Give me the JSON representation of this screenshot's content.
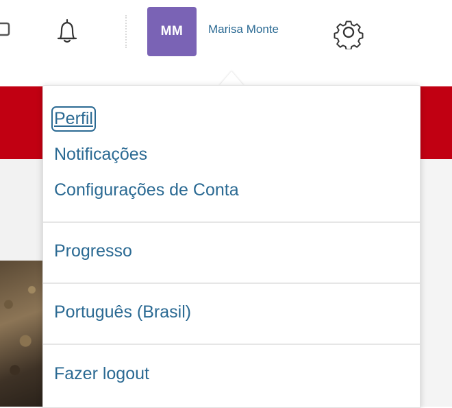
{
  "header": {
    "user_initials": "MM",
    "user_name": "Marisa Monte",
    "avatar_color": "#7a63b5",
    "icons": [
      "partial-icon",
      "bell-icon",
      "gear-icon"
    ]
  },
  "menu": {
    "items": [
      {
        "label": "Perfil"
      },
      {
        "label": "Notificações"
      },
      {
        "label": "Configurações de Conta"
      },
      {
        "label": "Progresso"
      },
      {
        "label": "Português (Brasil)"
      },
      {
        "label": "Fazer logout"
      }
    ],
    "focused_item": "Perfil",
    "link_color": "#2b6a93"
  },
  "background": {
    "banner_color": "#c10012"
  }
}
